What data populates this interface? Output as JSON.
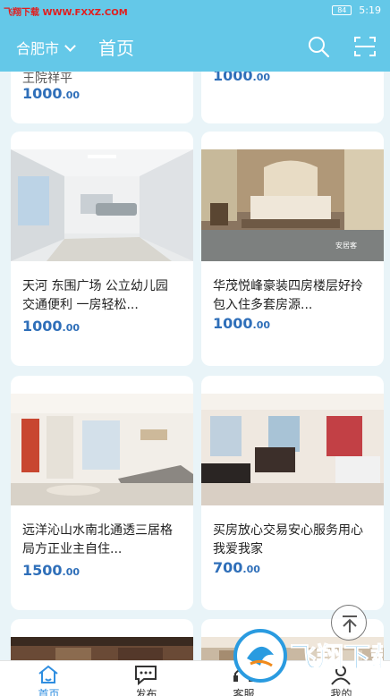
{
  "status_bar": {
    "watermark": "飞翔下载 WWW.FXXZ.COM",
    "battery": "84",
    "time": "5:19"
  },
  "header": {
    "city": "合肥市",
    "title": "首页"
  },
  "listings": [
    {
      "desc": "",
      "desc_tail": "王院祥平",
      "price_int": "1000",
      "price_dec": ".00"
    },
    {
      "desc": "",
      "price_int": "1000",
      "price_dec": ".00"
    },
    {
      "desc": "天河 东围广场 公立幼儿园 交通便利 一房轻松...",
      "price_int": "1000",
      "price_dec": ".00"
    },
    {
      "desc": "华茂悦峰豪装四房楼层好拎包入住多套房源...",
      "price_int": "1000",
      "price_dec": ".00"
    },
    {
      "desc": "远洋沁山水南北通透三居格局方正业主自住...",
      "price_int": "1500",
      "price_dec": ".00"
    },
    {
      "desc": "买房放心交易安心服务用心我爱我家",
      "price_int": "700",
      "price_dec": ".00"
    }
  ],
  "photo_badge": "安居客",
  "tabs": [
    {
      "label": "首页",
      "icon": "home-icon",
      "active": true
    },
    {
      "label": "发布",
      "icon": "message-icon",
      "active": false
    },
    {
      "label": "客服",
      "icon": "headset-icon",
      "active": false
    },
    {
      "label": "我的",
      "icon": "user-icon",
      "active": false
    }
  ],
  "brand": "飞翔下载",
  "colors": {
    "accent": "#64c8e8",
    "price": "#2f6fb9",
    "tab_active": "#2f8ee0"
  }
}
